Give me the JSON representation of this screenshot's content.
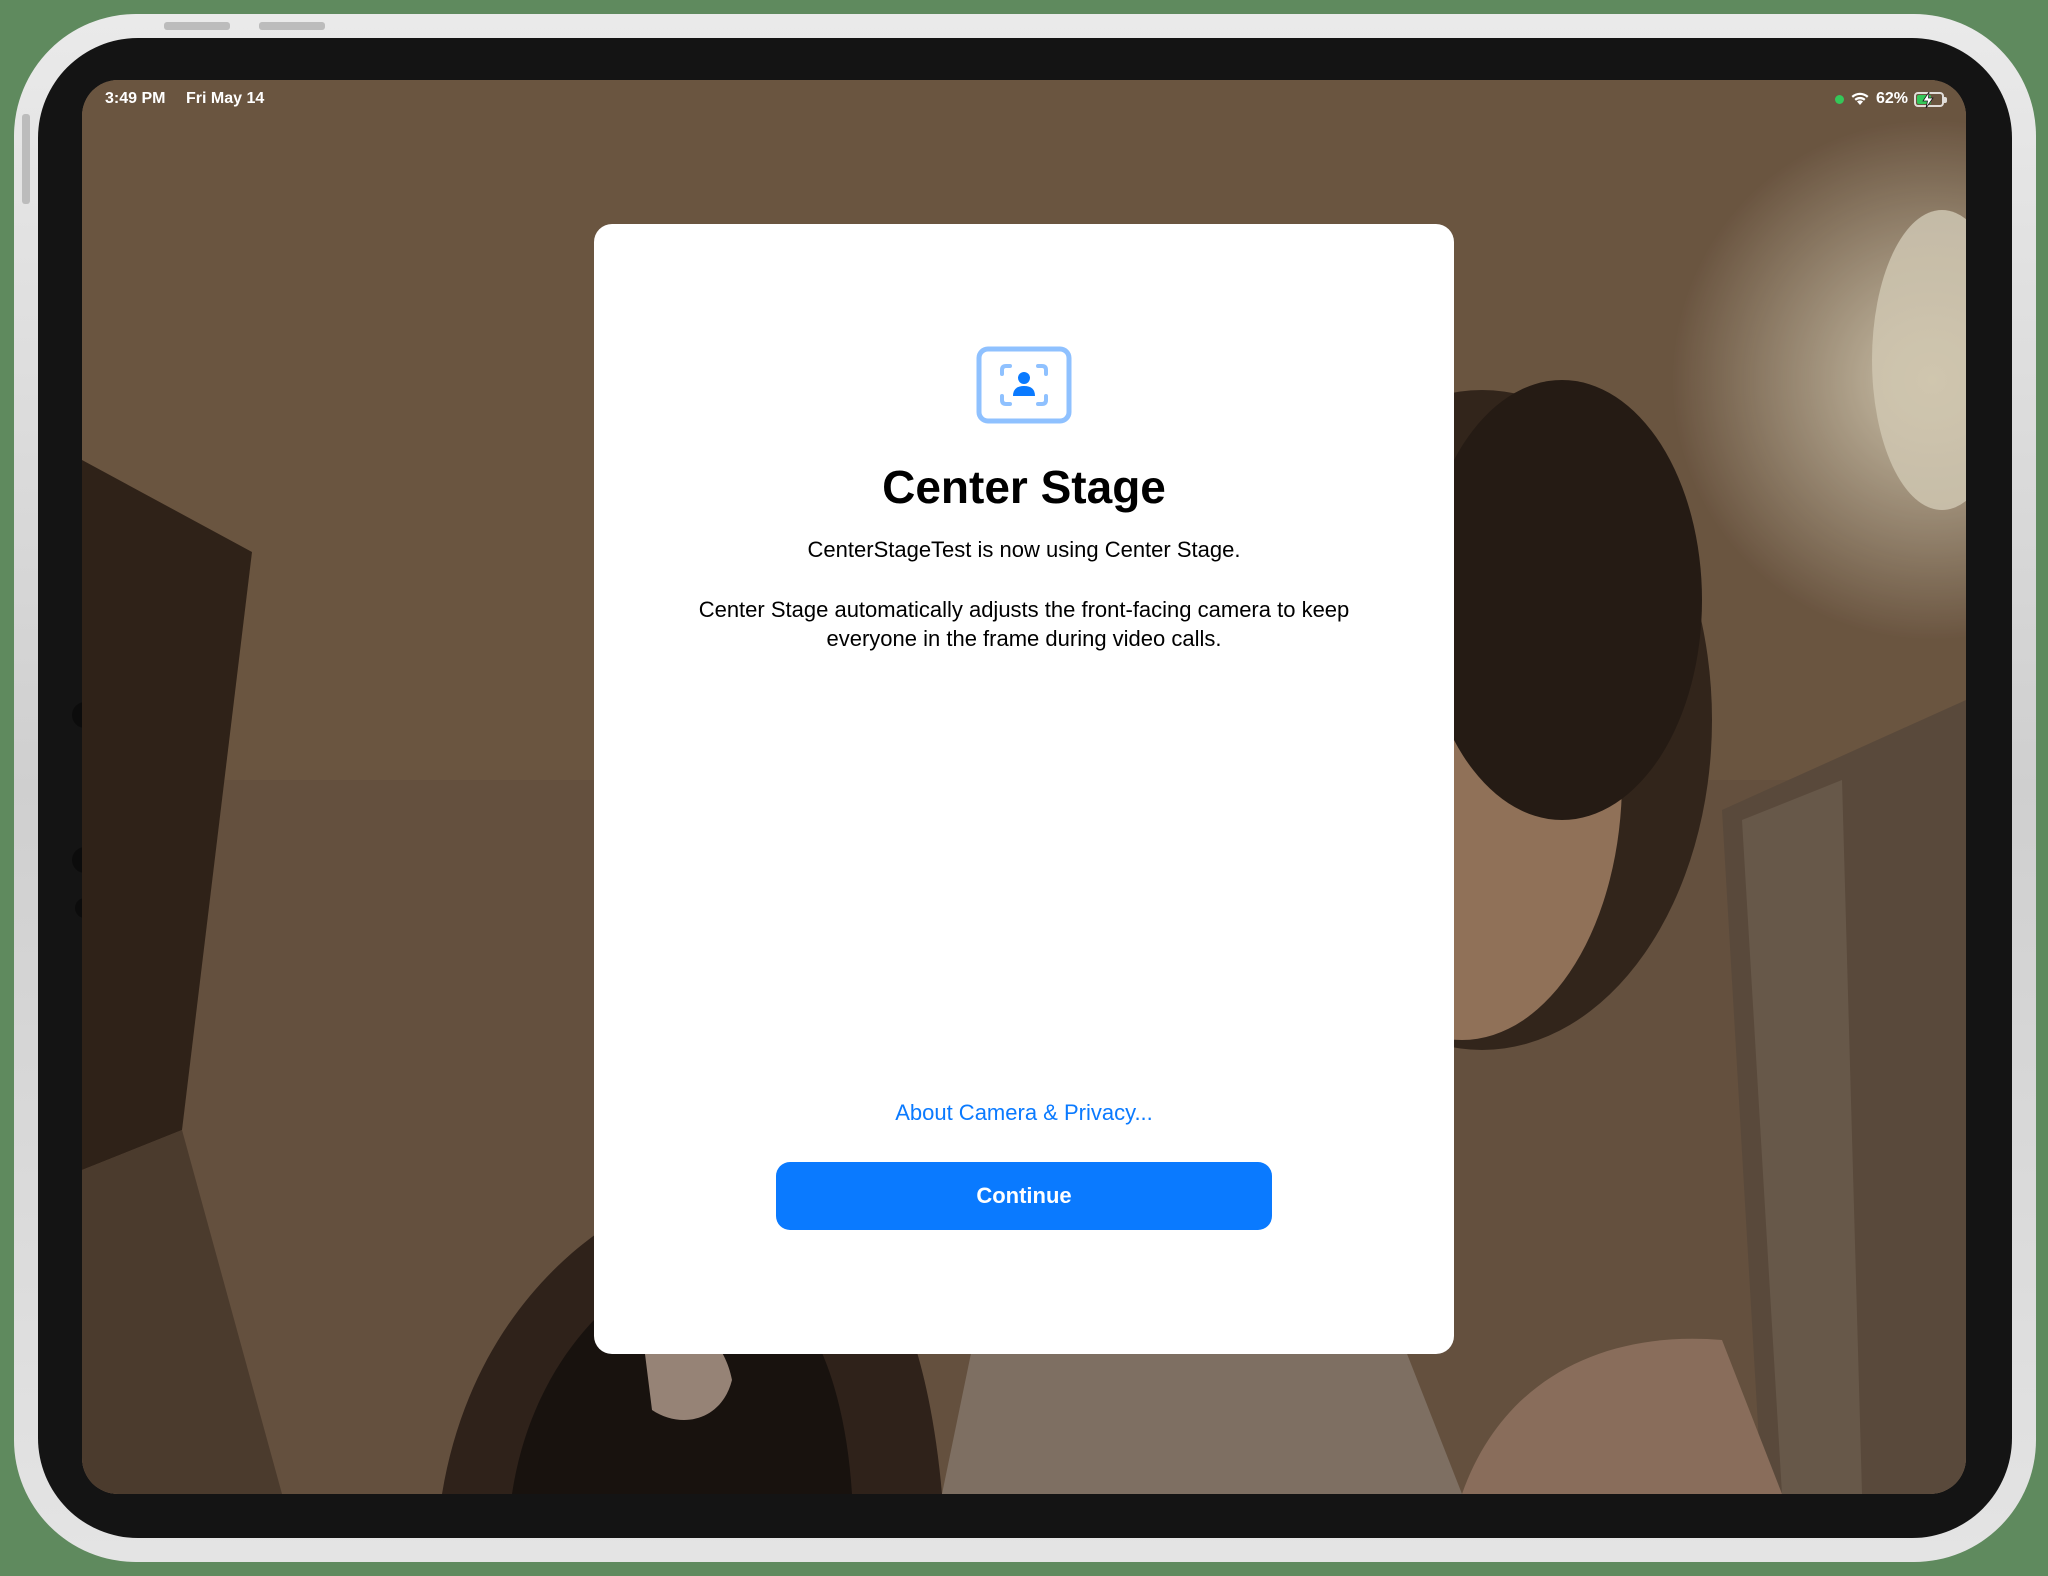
{
  "status_bar": {
    "time": "3:49 PM",
    "date": "Fri May 14",
    "battery_percent": "62%",
    "battery_level": 0.62,
    "wifi_icon": "wifi-icon",
    "battery_icon": "battery-charging-icon"
  },
  "modal": {
    "icon": "center-stage-icon",
    "title": "Center Stage",
    "subtitle": "CenterStageTest is now using Center Stage.",
    "description": "Center Stage automatically adjusts the front-facing camera to keep everyone in the frame during video calls.",
    "privacy_link": "About Camera & Privacy...",
    "continue_label": "Continue"
  },
  "colors": {
    "accent": "#0a7aff",
    "icon_tint": "#8fc1ff",
    "battery_green": "#34c759",
    "recording_dot": "#34c759"
  }
}
